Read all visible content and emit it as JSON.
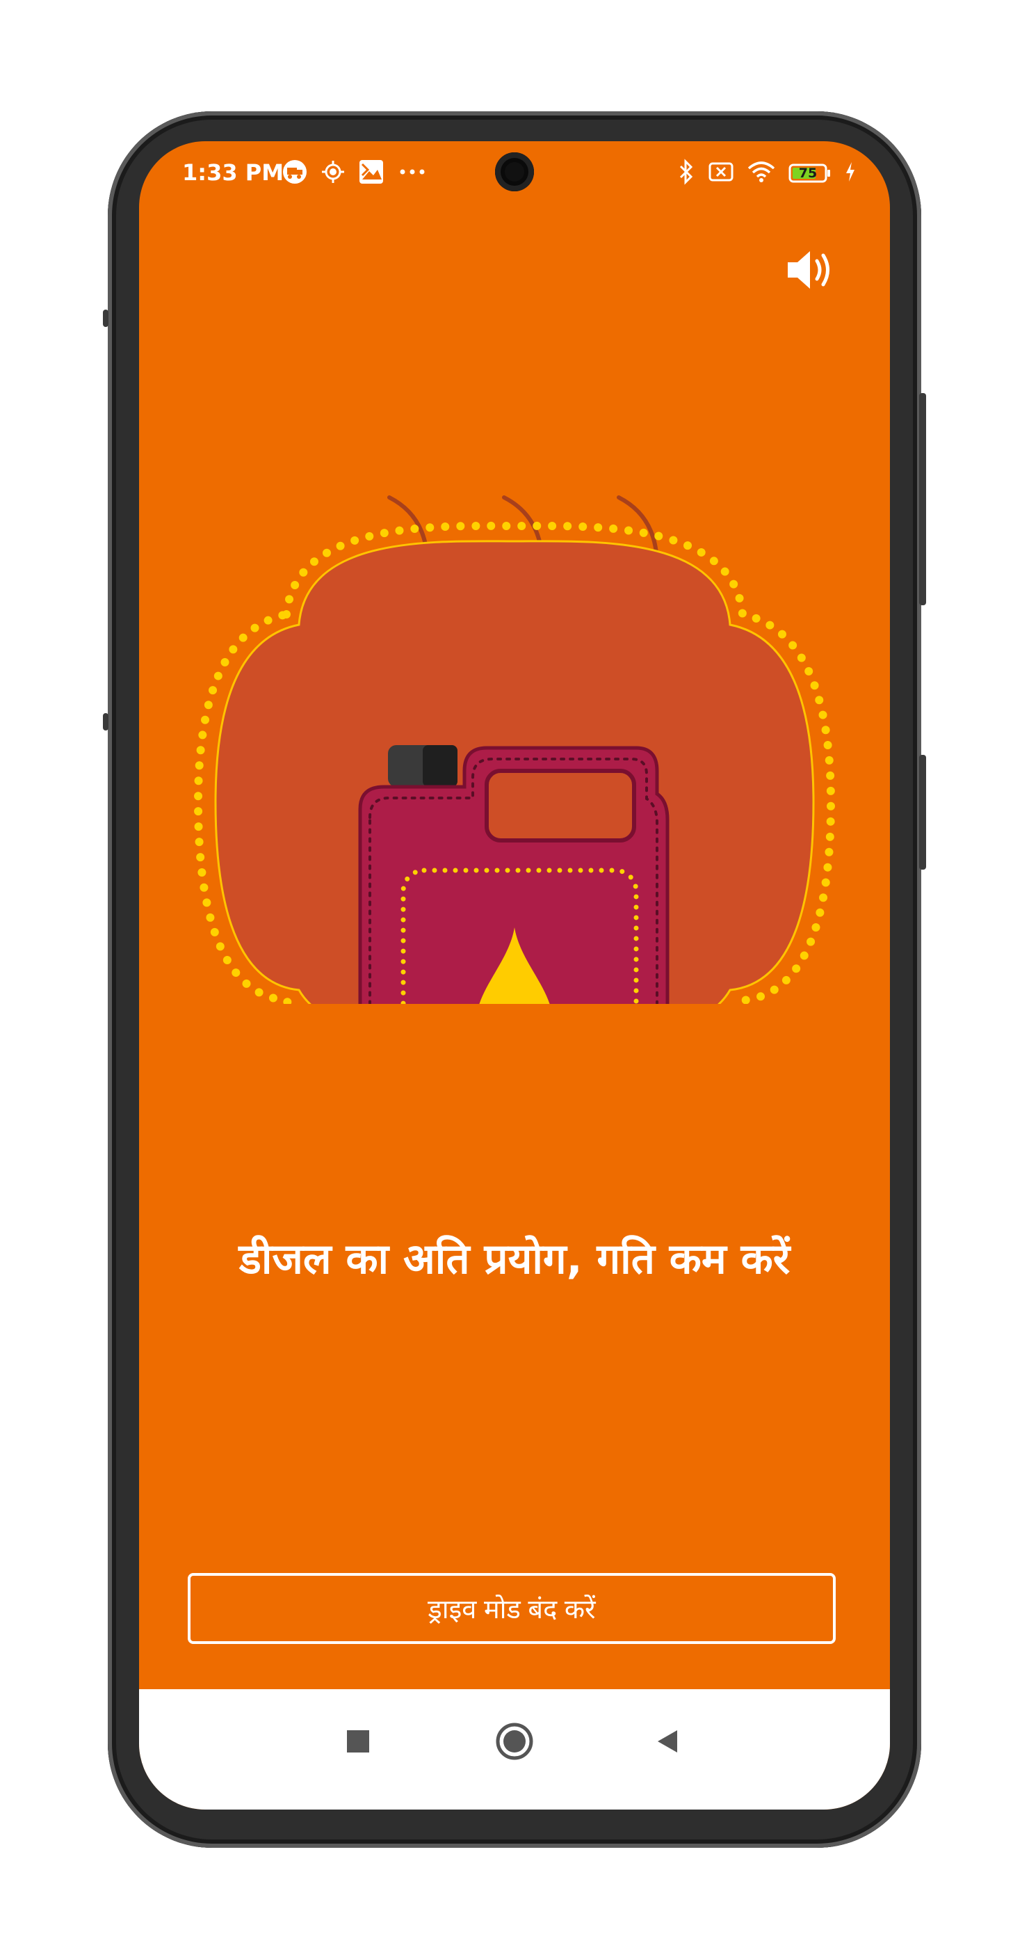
{
  "status_bar": {
    "time": "1:33 PM",
    "battery_level": "75",
    "icons_left": [
      "truck-app-icon",
      "location-icon",
      "gallery-icon",
      "more-notifications-icon"
    ],
    "icons_right": [
      "bluetooth-icon",
      "no-sim-icon",
      "wifi-icon",
      "battery-icon",
      "charging-icon"
    ]
  },
  "volume": {
    "icon": "speaker-on-icon"
  },
  "illustration": {
    "subject": "fuel-can-icon",
    "colors": {
      "background": "#EE6C00",
      "blob": "#CE4E26",
      "dots": "#FFD200",
      "can": "#AD1D48",
      "can_dark": "#4F0E24",
      "drop": "#FFCC00"
    }
  },
  "alert": {
    "message": "डीजल का अति प्रयोग, गति कम करें"
  },
  "actions": {
    "stop_drive_mode": "ड्राइव मोड बंद करें"
  },
  "nav": {
    "recents_icon": "square-recents-icon",
    "home_icon": "circle-home-icon",
    "back_icon": "triangle-back-icon"
  }
}
